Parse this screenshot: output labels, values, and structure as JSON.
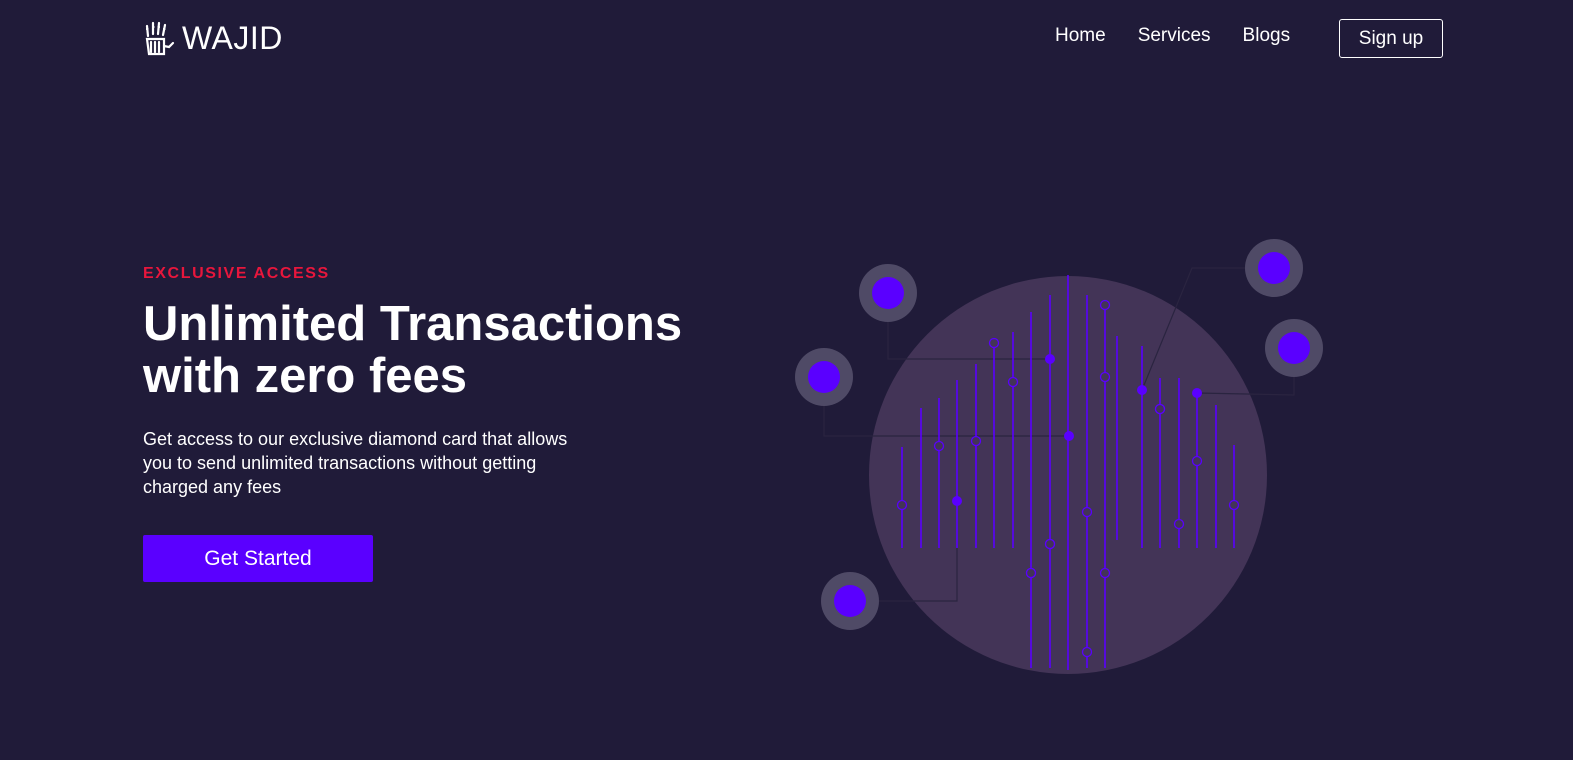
{
  "brand": {
    "name": "WAJID",
    "icon": "robot-hand-icon"
  },
  "nav": {
    "items": [
      {
        "label": "Home"
      },
      {
        "label": "Services"
      },
      {
        "label": "Blogs"
      }
    ],
    "signup_label": "Sign up"
  },
  "hero": {
    "eyebrow": "EXCLUSIVE ACCESS",
    "headline_line1": "Unlimited Transactions",
    "headline_line2": "with zero fees",
    "body": "Get access to our exclusive diamond card that allows you to send unlimited transactions without getting charged any fees",
    "cta_label": "Get Started"
  },
  "colors": {
    "background": "#201b39",
    "accent": "#5a00ff",
    "eyebrow": "#e8163c",
    "circle": "#433457",
    "node_ring": "#4f4a66"
  },
  "illustration": {
    "icon": "circuit-globe-illustration"
  }
}
